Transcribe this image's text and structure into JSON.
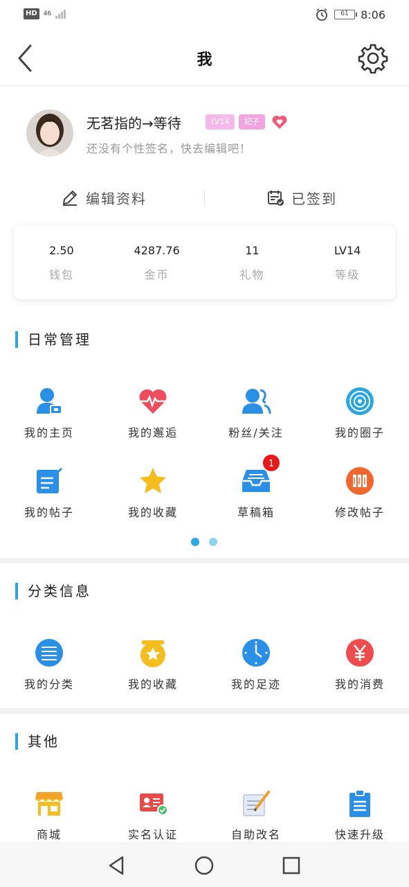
{
  "status_bar": {
    "hd": "HD",
    "network": "46",
    "battery": "61",
    "battery_fraction": 0.61,
    "time": "8:06"
  },
  "header": {
    "title": "我"
  },
  "profile": {
    "nickname": "无茗指的→等待",
    "level_badge": "LV14",
    "title_badge": "妃子",
    "signature": "还没有个性签名，快去编辑吧！",
    "edit_label": "编辑资料",
    "signin_label": "已签到"
  },
  "stats": [
    {
      "value": "2.50",
      "label": "钱包"
    },
    {
      "value": "4287.76",
      "label": "金币"
    },
    {
      "value": "11",
      "label": "礼物"
    },
    {
      "value": "LV14",
      "label": "等级"
    }
  ],
  "daily": {
    "title": "日常管理",
    "items": [
      {
        "label": "我的主页",
        "icon": "user-home-icon"
      },
      {
        "label": "我的邂逅",
        "icon": "heartbeat-icon"
      },
      {
        "label": "粉丝/关注",
        "icon": "followers-icon"
      },
      {
        "label": "我的圈子",
        "icon": "circle-target-icon"
      },
      {
        "label": "我的帖子",
        "icon": "post-edit-icon"
      },
      {
        "label": "我的收藏",
        "icon": "star-icon"
      },
      {
        "label": "草稿箱",
        "icon": "inbox-icon",
        "badge": "1"
      },
      {
        "label": "修改帖子",
        "icon": "books-icon"
      }
    ],
    "page_indicator": {
      "pages": 2,
      "current": 1
    }
  },
  "category": {
    "title": "分类信息",
    "items": [
      {
        "label": "我的分类",
        "icon": "list-icon"
      },
      {
        "label": "我的收藏",
        "icon": "star-box-icon"
      },
      {
        "label": "我的足迹",
        "icon": "clock-icon"
      },
      {
        "label": "我的消费",
        "icon": "yen-icon"
      }
    ]
  },
  "other": {
    "title": "其他",
    "items": [
      {
        "label": "商城",
        "icon": "shop-icon"
      },
      {
        "label": "实名认证",
        "icon": "id-card-icon"
      },
      {
        "label": "自助改名",
        "icon": "rename-icon"
      },
      {
        "label": "快速升级",
        "icon": "clipboard-upgrade-icon"
      }
    ]
  },
  "colors": {
    "accent": "#2aa6e0",
    "badge_pink": "#f5b8ea",
    "notify_red": "#e8181c"
  }
}
